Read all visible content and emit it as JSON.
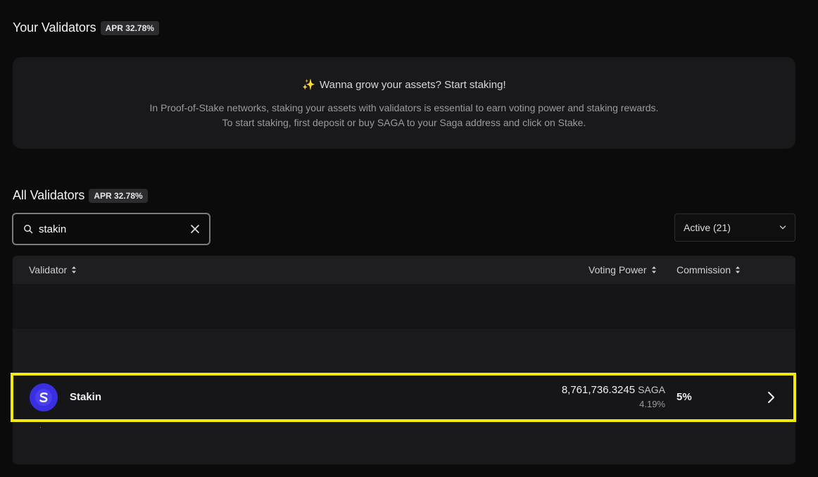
{
  "your_validators": {
    "title": "Your Validators",
    "apr_badge": "APR 32.78%",
    "empty_state": {
      "icon": "sparkles-icon",
      "headline": "Wanna grow your assets? Start staking!",
      "line1": "In Proof-of-Stake networks, staking your assets with validators is essential to earn voting power and staking rewards.",
      "line2": "To start staking, first deposit or buy SAGA to your Saga address and click on Stake."
    }
  },
  "all_validators": {
    "title": "All Validators",
    "apr_badge": "APR 32.78%",
    "search": {
      "value": "stakin",
      "placeholder": ""
    },
    "status_filter": {
      "selected": "Active (21)"
    },
    "table": {
      "columns": {
        "validator": "Validator",
        "voting_power": "Voting Power",
        "commission": "Commission"
      },
      "rows": [
        {
          "name": "Stakin",
          "voting_power": "8,761,736.3245",
          "unit": "SAGA",
          "voting_power_pct": "4.19%",
          "commission": "5%"
        }
      ]
    }
  },
  "colors": {
    "highlight": "#f2ea0f",
    "avatar": "#3a2fe0"
  }
}
